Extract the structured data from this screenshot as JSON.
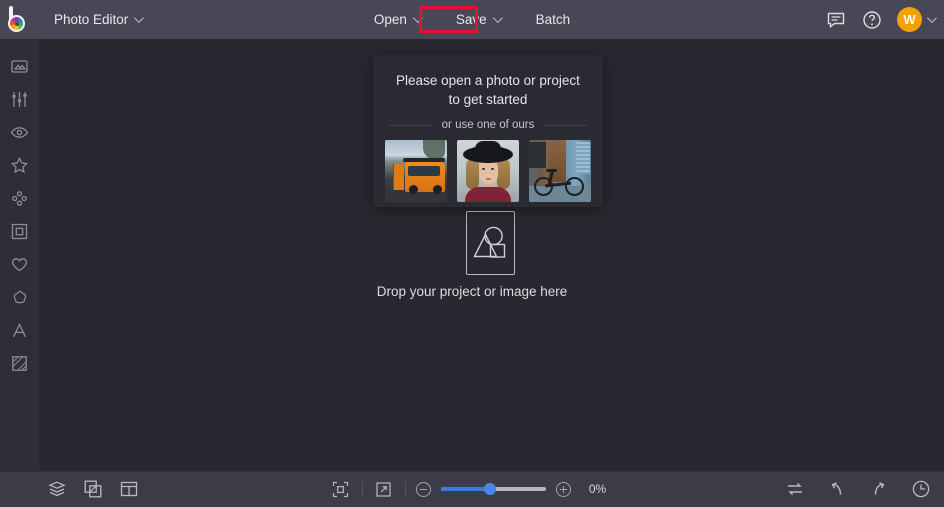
{
  "app": {
    "logo_name": "befunky-logo",
    "accent_orange": "#f5a000",
    "accent_blue": "#3b7ddd",
    "highlight_red": "#e8112d",
    "header_bg": "#474755",
    "canvas_bg": "#282830",
    "sidebar_bg": "#2e2e38",
    "footer_bg": "#3c3c48",
    "popup_bg": "#2a2a33"
  },
  "header": {
    "app_menu_label": "Photo Editor",
    "buttons": [
      {
        "label": "Open",
        "has_caret": true,
        "highlighted": true
      },
      {
        "label": "Save",
        "has_caret": true,
        "highlighted": false
      },
      {
        "label": "Batch",
        "has_caret": false,
        "highlighted": false
      }
    ],
    "right_icons": [
      {
        "name": "chat-icon",
        "title": "Chat"
      },
      {
        "name": "help-icon",
        "title": "Help"
      }
    ],
    "avatar": {
      "initial": "W",
      "color": "#f5a000"
    }
  },
  "sidebar": {
    "items": [
      {
        "label": "Photo",
        "icon": "image-icon"
      },
      {
        "label": "Edit",
        "icon": "sliders-icon"
      },
      {
        "label": "Touch Up",
        "icon": "eye-icon"
      },
      {
        "label": "Effects",
        "icon": "star-icon"
      },
      {
        "label": "Artsy",
        "icon": "dots-icon"
      },
      {
        "label": "Overlays",
        "icon": "frame-square-icon"
      },
      {
        "label": "Graphics",
        "icon": "heart-icon"
      },
      {
        "label": "Textures",
        "icon": "blob-icon"
      },
      {
        "label": "Text",
        "icon": "text-a-icon"
      },
      {
        "label": "Frames",
        "icon": "hatched-square-icon"
      }
    ]
  },
  "popup": {
    "title": "Please open a photo or project to get started",
    "or_text": "or use one of ours",
    "samples": [
      {
        "name": "sample-orange-van",
        "alt": "Orange camper van at the beach"
      },
      {
        "name": "sample-portrait-hat",
        "alt": "Portrait of woman wearing a black hat"
      },
      {
        "name": "sample-bicycle-wall",
        "alt": "Bicycle leaning on a blue wall"
      }
    ]
  },
  "canvas": {
    "dropzone_icon": "shapes-placeholder-icon",
    "drop_text": "Drop your project or image here"
  },
  "footer": {
    "left_icons": [
      {
        "name": "layers-icon",
        "title": "Layers"
      },
      {
        "name": "image-overlay-icon",
        "title": "Image Manager"
      },
      {
        "name": "collage-grid-icon",
        "title": "Collage"
      }
    ],
    "view_icons": [
      {
        "name": "fit-to-screen-icon",
        "title": "Fit to screen"
      },
      {
        "name": "fullscreen-icon",
        "title": "Fullscreen"
      }
    ],
    "zoom": {
      "minus_label": "−",
      "plus_label": "+",
      "value": "0%",
      "slider_percent": 47
    },
    "right_icons": [
      {
        "name": "compare-icon",
        "title": "Compare"
      },
      {
        "name": "undo-icon",
        "title": "Undo"
      },
      {
        "name": "redo-icon",
        "title": "Redo"
      },
      {
        "name": "history-clock-icon",
        "title": "History"
      }
    ]
  }
}
